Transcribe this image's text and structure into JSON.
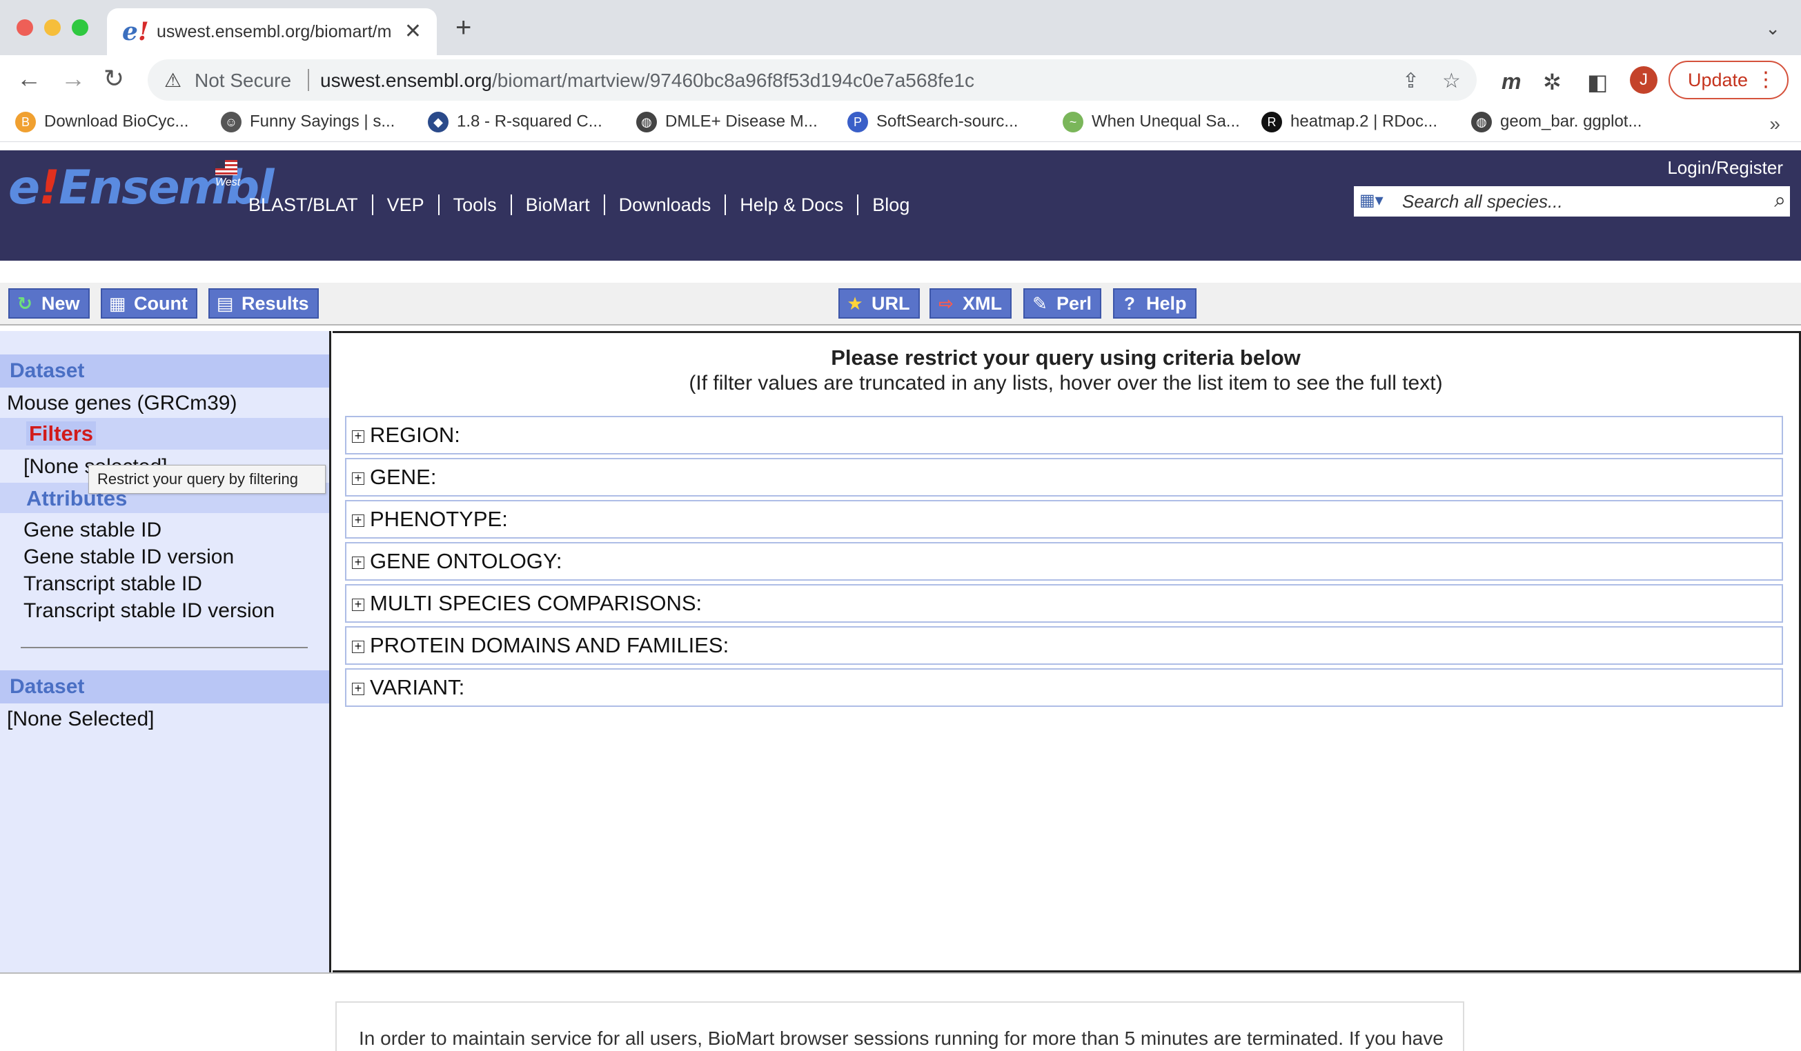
{
  "browser": {
    "tab_title": "uswest.ensembl.org/biomart/m",
    "tab_favicon": "e!",
    "omnibox": {
      "security_label": "Not Secure",
      "url_host": "uswest.ensembl.org",
      "url_path": "/biomart/martview/97460bc8a96f8f53d194c0e7a568fe1c"
    },
    "profile_initial": "J",
    "update_label": "Update",
    "bookmarks": [
      {
        "label": "Download BioCyc...",
        "color": "#f0a030",
        "glyph": "B"
      },
      {
        "label": "Funny Sayings | s...",
        "color": "#555555",
        "glyph": "☺"
      },
      {
        "label": "1.8 - R-squared C...",
        "color": "#2a4a8a",
        "glyph": "◆"
      },
      {
        "label": "DMLE+ Disease M...",
        "color": "#444444",
        "glyph": "◍"
      },
      {
        "label": "SoftSearch-sourc...",
        "color": "#3a5fc8",
        "glyph": "P"
      },
      {
        "label": "When Unequal Sa...",
        "color": "#7ab65a",
        "glyph": "~"
      },
      {
        "label": "heatmap.2 | RDoc...",
        "color": "#111111",
        "glyph": "R"
      },
      {
        "label": "geom_bar. ggplot...",
        "color": "#444444",
        "glyph": "◍"
      }
    ]
  },
  "ensembl": {
    "logo_e": "e",
    "logo_bang": "!",
    "logo_text": "Ensembl",
    "logo_sub": "West",
    "nav": [
      "BLAST/BLAT",
      "VEP",
      "Tools",
      "BioMart",
      "Downloads",
      "Help & Docs",
      "Blog"
    ],
    "login": "Login/Register",
    "search_placeholder": "Search all species..."
  },
  "martbar": {
    "left_buttons": [
      "New",
      "Count",
      "Results"
    ],
    "right_buttons": [
      "URL",
      "XML",
      "Perl",
      "Help"
    ]
  },
  "sidebar": {
    "dataset_heading": "Dataset",
    "dataset_value": "Mouse genes (GRCm39)",
    "filters_label": "Filters",
    "filters_value": "[None selected]",
    "attributes_label": "Attributes",
    "attributes": [
      "Gene stable ID",
      "Gene stable ID version",
      "Transcript stable ID",
      "Transcript stable ID version"
    ],
    "dataset2_heading": "Dataset",
    "dataset2_value": "[None Selected]",
    "tooltip": "Restrict your query by filtering"
  },
  "main": {
    "title": "Please restrict your query using criteria below",
    "subtitle": "(If filter values are truncated in any lists, hover over the list item to see the full text)",
    "filter_sections": [
      "REGION:",
      "GENE:",
      "PHENOTYPE:",
      "GENE ONTOLOGY:",
      "MULTI SPECIES COMPARISONS:",
      "PROTEIN DOMAINS AND FAMILIES:",
      "VARIANT:"
    ]
  },
  "footer": {
    "notice": "In order to maintain service for all users, BioMart browser sessions running for more than 5 minutes are terminated. If you have"
  },
  "colors": {
    "header_bg": "#33335e",
    "button_blue": "#5973c9",
    "sidebar_bg": "#e4e9fc",
    "section_head": "#b9c6f5",
    "filters_red": "#d11b1b"
  }
}
